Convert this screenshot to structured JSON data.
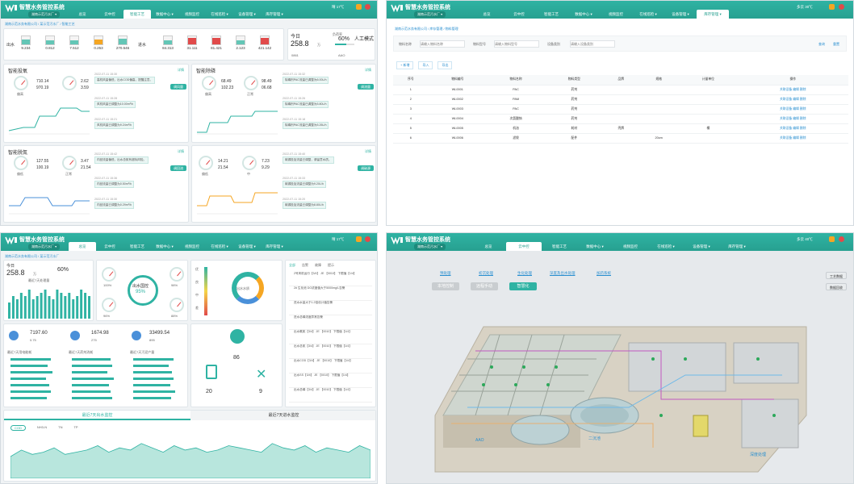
{
  "app": {
    "title": "智慧水务管控系统",
    "logo_text": "WISEMP"
  },
  "colors": {
    "brand": "#2fb3a3",
    "brand_dark": "#1d8a7b",
    "link": "#2a8fd0",
    "alarm": "#e14a4a",
    "warn": "#f5a623",
    "chart_fill": "#63c6b6"
  },
  "p1": {
    "site": "湖南示范污水厂 ▾",
    "nav": [
      "总览",
      "云中控",
      "智能工艺",
      "数据中心 ▾",
      "视频监控",
      "在线巡检 ▾",
      "设备管理 ▾",
      "库存管理 ▾"
    ],
    "active_nav": "智能工艺",
    "weather": "晴 17℃",
    "crumb": "湖南示范水务有限公司 / 某示范污水厂 / 智能工艺",
    "inlet_label": "出水",
    "inlet_kpis": [
      {
        "value": "9.234",
        "color": "#63c6b6",
        "level": 0.6
      },
      {
        "value": "0.812",
        "color": "#63c6b6",
        "level": 0.55
      },
      {
        "value": "7.512",
        "color": "#63c6b6",
        "level": 0.5
      },
      {
        "value": "0.253",
        "color": "#f5a623",
        "level": 0.65
      },
      {
        "value": "270.546",
        "color": "#63c6b6",
        "level": 0.75
      }
    ],
    "outlet_label": "进水",
    "outlet_kpis": [
      {
        "value": "84.313",
        "color": "#63c6b6",
        "level": 0.55
      },
      {
        "value": "31.111",
        "color": "#e14a4a",
        "level": 0.8
      },
      {
        "value": "81.421",
        "color": "#e14a4a",
        "level": 0.8
      },
      {
        "value": "2.123",
        "color": "#63c6b6",
        "level": 0.55
      },
      {
        "value": "421.142",
        "color": "#e14a4a",
        "level": 0.8
      }
    ],
    "today": {
      "label": "今日",
      "value": "258.8",
      "unit": "万",
      "load_label": "负荷率",
      "load": "60%",
      "sub1": "0861",
      "sub2": "AAO"
    },
    "manual_mode": "人工模式",
    "cards": [
      {
        "title": "智能投氧",
        "more": "详情",
        "g1": "偏高",
        "g2": "正常",
        "v1": "710.14",
        "v2": "2.62",
        "v3": "970.19",
        "v4": "3.59",
        "events": [
          {
            "date": "2022-07-11 15:30",
            "text": "高机风量偏低，出水COD偏高，提醒注意。"
          },
          {
            "date": "2022-07-11 15:28",
            "text": "风机风量已调整为10.00m³/h"
          },
          {
            "date": "2022-07-11 15:21",
            "text": "风机风量已调整为9.24m³/h"
          }
        ],
        "btn": "调风量"
      },
      {
        "title": "智能除磷",
        "more": "详情",
        "g1": "偏高",
        "g2": "正常",
        "v1": "68.49",
        "v2": "98.49",
        "v3": "102.23",
        "v4": "06.68",
        "events": [
          {
            "date": "2022-07-11 15:32",
            "text": "除磷剂PAC流量已调整为6.00L/h"
          },
          {
            "date": "2022-07-11 15:26",
            "text": "除磷剂PAC流量已调整为5.80L/h"
          },
          {
            "date": "2022-07-11 15:18",
            "text": "除磷剂PAC流量已调整为5.26L/h"
          }
        ],
        "btn": "调流量"
      },
      {
        "title": "智能脱氮",
        "more": "详情",
        "g1": "偏低",
        "g2": "正常",
        "v1": "127.55",
        "v2": "3.47",
        "v3": "100.19",
        "v4": "21.54",
        "events": [
          {
            "date": "2022-07-11 15:42",
            "text": "内回流量偏低，出水总氮有超标风险。"
          },
          {
            "date": "2022-07-11 15:36",
            "text": "内回流量已调整为0.50m³/h"
          },
          {
            "date": "2022-07-11 15:30",
            "text": "内回流量已调整为0.29m³/h"
          }
        ],
        "btn": "调回流"
      },
      {
        "title": "",
        "more": "详情",
        "g1": "偏低",
        "g2": "中",
        "v1": "14.21",
        "v2": "7.23",
        "v3": "21.54",
        "v4": "9.29",
        "events": [
          {
            "date": "2022-07-11 15:40",
            "text": "碳源投加流量已调整，请留意水质。"
          },
          {
            "date": "2022-07-11 15:33",
            "text": "碳源投加流量已调整为9.20L/h"
          },
          {
            "date": "2022-07-11 15:20",
            "text": "碳源投加流量已调整为8.80L/h"
          }
        ],
        "btn": "调碳源"
      }
    ]
  },
  "p2": {
    "site": "湖南示范污水厂 ▾",
    "nav": [
      "总览",
      "云中控",
      "智能工艺",
      "数据中心 ▾",
      "视频监控",
      "在线巡检 ▾",
      "设备管理 ▾",
      "库存管理 ▾"
    ],
    "active_nav": "库存管理 ▾",
    "weather": "多云 30℃",
    "crumb": "湖南示范水务有限公司 / 库存管理 / 物料管理",
    "filters": [
      {
        "label": "物料名称",
        "placeholder": "请输入物料名称"
      },
      {
        "label": "物料型号",
        "placeholder": "请输入物料型号"
      },
      {
        "label": "设备类别",
        "placeholder": "请输入设备类别"
      }
    ],
    "search_btn": "查询",
    "reset_btn": "重置",
    "actions": [
      "+ 新增",
      "导入",
      "导出"
    ],
    "headers": [
      "序号",
      "物料编号",
      "物料名称",
      "物料类型",
      "品牌",
      "规格",
      "计量单位",
      "操作"
    ],
    "rows": [
      [
        "1",
        "WL0001",
        "PAC",
        "药剂",
        "",
        "",
        "",
        "关联设备  编辑  删除"
      ],
      [
        "2",
        "WL0002",
        "PAM",
        "药剂",
        "",
        "",
        "",
        "关联设备  编辑  删除"
      ],
      [
        "3",
        "WL0003",
        "PAC",
        "药剂",
        "",
        "",
        "",
        "关联设备  编辑  删除"
      ],
      [
        "4",
        "WL0004",
        "次氯酸钠",
        "药剂",
        "",
        "",
        "",
        "关联设备  编辑  删除"
      ],
      [
        "5",
        "WL0005",
        "机油",
        "耗材",
        "壳牌",
        "",
        "桶",
        "关联设备  编辑  删除"
      ],
      [
        "6",
        "WL0006",
        "滤袋",
        "配件",
        "",
        "20cm",
        "",
        "关联设备  编辑  删除"
      ]
    ]
  },
  "p3": {
    "site": "湖南示范污水厂 ▾",
    "nav": [
      "总览",
      "云中控",
      "智能工艺",
      "数据中心 ▾",
      "视频监控",
      "在线巡检 ▾",
      "设备管理 ▾",
      "库存管理 ▾"
    ],
    "active_nav": "总览",
    "weather": "晴 17℃",
    "crumb": "湖南示范水务有限公司 / 某示范污水厂",
    "today_label": "今日",
    "today_value": "258.8",
    "today_unit": "万",
    "load": "60%",
    "bar_title": "最近7天处理量",
    "compliance_title": "出水国控",
    "compliance_value": "95%",
    "gauges": [
      "100%",
      "98%",
      "96%",
      "88%"
    ],
    "stats": [
      {
        "value": "7197.60",
        "unit": "kWh",
        "sub": "0.75"
      },
      {
        "value": "1674.98",
        "unit": "kg",
        "sub": "275"
      },
      {
        "value": "33499.54",
        "unit": "kg",
        "sub": "895"
      }
    ],
    "mini_titles": [
      "最近7天用电能耗",
      "最近7天药剂消耗",
      "最近7天污泥产量"
    ],
    "tank_labels": [
      "优",
      "良",
      "中",
      "差"
    ],
    "radar_center": "出水水质",
    "phone_value": "86",
    "battery_value": "20",
    "tool_value": "9",
    "alarm_tabs": [
      "全部",
      "告警",
      "故障",
      "提示"
    ],
    "alarms": [
      "2号风机运行【3/4】 JE 【0010】 下限值【1/4】",
      "2# 生化池 DO浓度值大于5000mg/L告警",
      "进水水量大于1.2倍设计值告警",
      "进水总磷浓度异常告警",
      "出水氨氮【3/4】 JE 【0010】 下限值【1/4】",
      "出水总氮【3/4】 JE 【0010】 下限值【1/4】",
      "出水COD【3/4】 JE 【0010】 下限值【1/4】",
      "出水SS【3/4】 JE 【0010】 下限值【1/4】",
      "出水总磷【3/4】 JE 【0010】 下限值【1/4】"
    ],
    "bottom_tabs": [
      "最近7天出水监控",
      "最近7天进水监控"
    ],
    "series_tabs": [
      "COD",
      "NH3-N",
      "TN",
      "TP"
    ]
  },
  "p4": {
    "site": "湖南示范污水厂 ▾",
    "nav": [
      "总览",
      "云中控",
      "智能工艺",
      "数据中心 ▾",
      "视频监控",
      "在线巡检 ▾",
      "设备管理 ▾",
      "库存管理 ▾"
    ],
    "active_nav": "云中控",
    "weather": "多云 40℃",
    "links": [
      "预处理",
      "初沉处理",
      "生化处理",
      "深度及出水处理",
      "加药系统"
    ],
    "modes": [
      "本地控制",
      "远程手动",
      "智慧化"
    ],
    "side_btns": [
      "工艺数据",
      "数据回收"
    ],
    "labels": {
      "aao": "AAO",
      "sedimentation": "二沉池",
      "deep": "深度处理"
    }
  },
  "chart_data": [
    {
      "type": "bar",
      "title": "最近7天处理量",
      "categories": [
        "1",
        "2",
        "3",
        "4",
        "5",
        "6",
        "7",
        "8",
        "9",
        "10",
        "11",
        "12",
        "13",
        "14",
        "15",
        "16",
        "17",
        "18",
        "19",
        "20",
        "21"
      ],
      "values": [
        5,
        7,
        6,
        8,
        7,
        9,
        6,
        7,
        8,
        9,
        7,
        6,
        9,
        8,
        7,
        8,
        6,
        7,
        9,
        8,
        7
      ]
    },
    {
      "type": "area",
      "title": "最近7天出水监控",
      "series": [
        {
          "name": "COD",
          "values": [
            10,
            13,
            11,
            12,
            14,
            11,
            12,
            13,
            15,
            12,
            14,
            13,
            16,
            14,
            12,
            15,
            13,
            14,
            12,
            13,
            15,
            14,
            13,
            12,
            16,
            14,
            13,
            15,
            12,
            14,
            13,
            12,
            15,
            13
          ]
        }
      ]
    }
  ]
}
